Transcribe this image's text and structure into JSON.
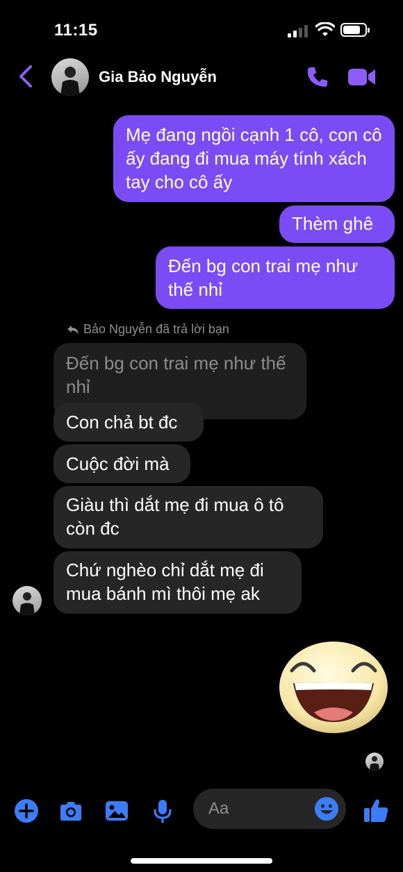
{
  "status_bar": {
    "time": "11:15"
  },
  "header": {
    "contact_name": "Gia Bảo Nguyễn"
  },
  "messages": {
    "outgoing": [
      "Mẹ đang ngồi cạnh 1 cô, con cô ấy đang đi mua máy tính xách tay cho cô ấy",
      "Thèm ghê",
      "Đến bg con trai mẹ như thế nhỉ"
    ],
    "reply_note": "Bảo Nguyễn đã trả lời bạn",
    "quoted_text": "Đến bg con trai mẹ như thế nhỉ",
    "incoming": [
      "Con chả bt đc",
      "Cuộc đời mà",
      "Giàu thì dắt mẹ đi mua ô tô còn đc",
      "Chứ nghèo chỉ dắt mẹ đi mua bánh mì thôi mẹ ak"
    ]
  },
  "composer": {
    "placeholder": "Aa"
  },
  "colors": {
    "accent": "#7b4cf6",
    "icon_blue": "#3b7cf7",
    "incoming_bubble": "#262626"
  }
}
